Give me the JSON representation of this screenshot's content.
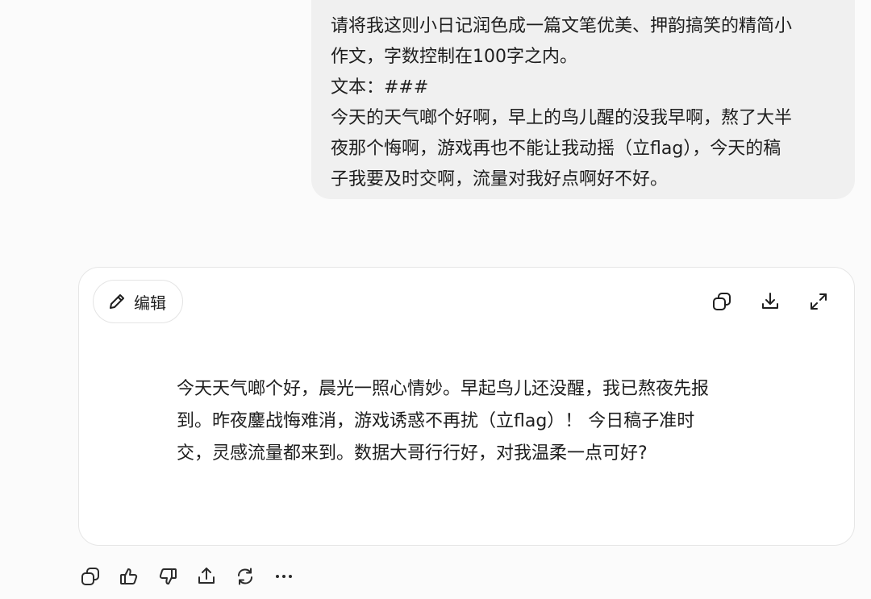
{
  "user_message": {
    "lines": [
      "请将我这则小日记润色成一篇文笔优美、押韵搞笑的精简小",
      "作文，字数控制在100字之内。",
      "文本：###",
      "今天的天气啷个好啊，早上的鸟儿醒的没我早啊，熬了大半",
      "夜那个悔啊，游戏再也不能让我动摇（立flag），今天的稿",
      "子我要及时交啊，流量对我好点啊好不好。"
    ]
  },
  "response_card": {
    "edit_label": "编辑",
    "tools": [
      "copy-icon",
      "download-icon",
      "expand-icon"
    ],
    "lines": [
      "今天天气啷个好，晨光一照心情妙。早起鸟儿还没醒，我已熬夜先报",
      "到。昨夜鏖战悔难消，游戏诱惑不再扰（立flag）！ 今日稿子准时",
      "交，灵感流量都来到。数据大哥行行好，对我温柔一点可好?"
    ]
  },
  "action_bar": [
    "copy-icon",
    "thumbs-up-icon",
    "thumbs-down-icon",
    "share-icon",
    "regenerate-icon",
    "more-icon"
  ]
}
